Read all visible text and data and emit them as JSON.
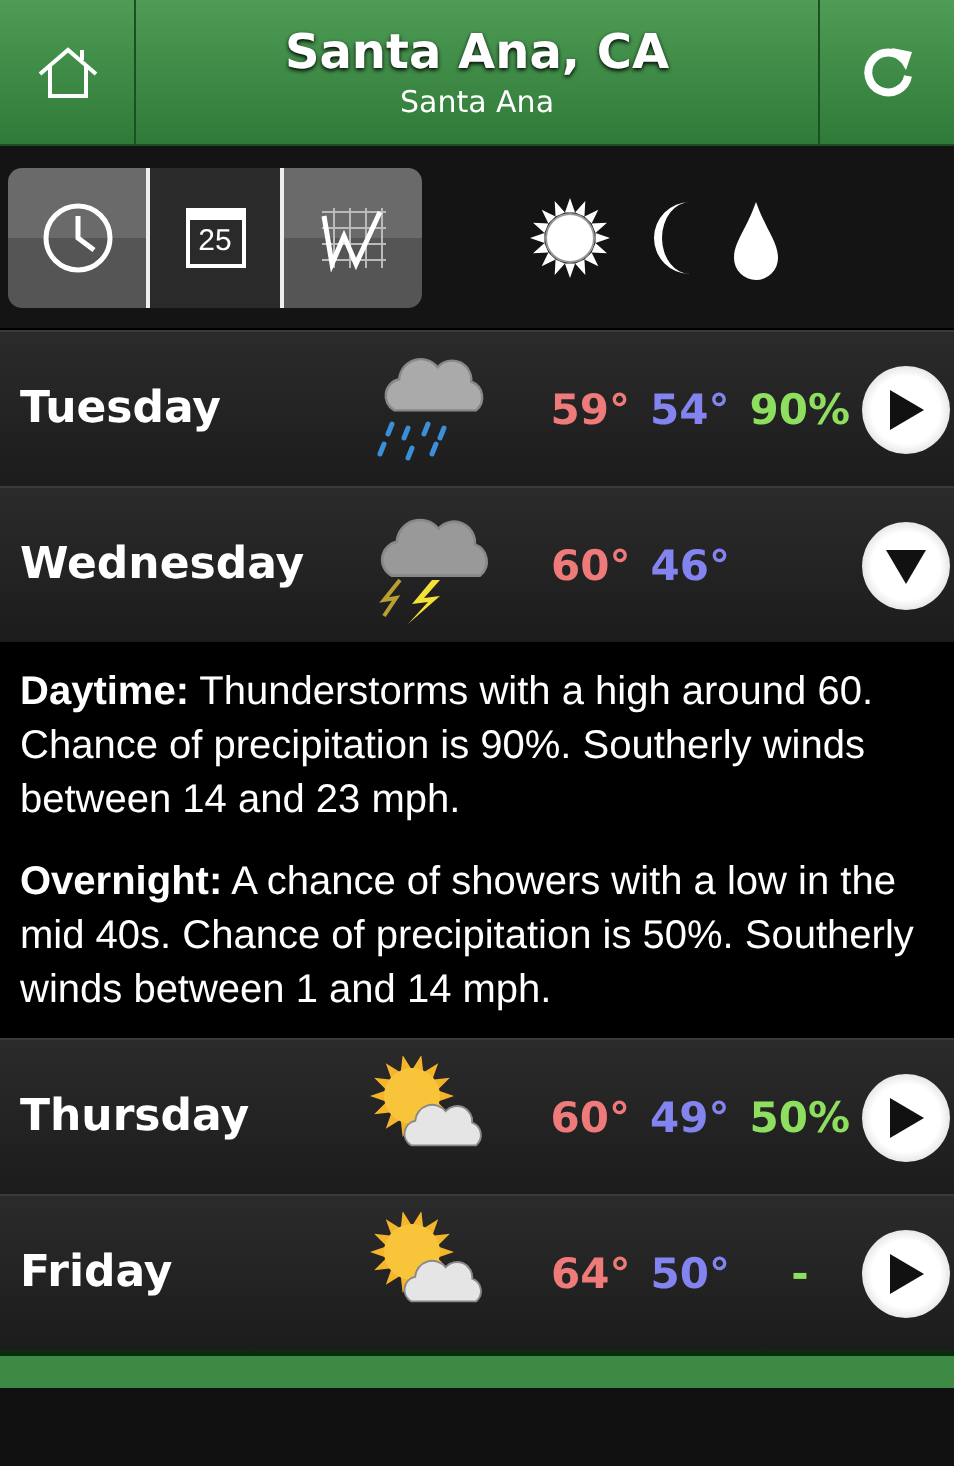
{
  "header": {
    "title": "Santa Ana, CA",
    "subtitle": "Santa Ana"
  },
  "view_tabs": [
    {
      "kind": "clock",
      "selected": false
    },
    {
      "kind": "calendar",
      "label": "25",
      "selected": true
    },
    {
      "kind": "chart",
      "selected": false
    }
  ],
  "legend": [
    {
      "kind": "sun"
    },
    {
      "kind": "moon"
    },
    {
      "kind": "drop"
    }
  ],
  "days": [
    {
      "name": "Tuesday",
      "kind": "rain",
      "high": "59°",
      "low": "54°",
      "precip": "90%",
      "expanded": false
    },
    {
      "name": "Wednesday",
      "kind": "storm",
      "high": "60°",
      "low": "46°",
      "expanded": true,
      "details": [
        "**Daytime:** Thunderstorms with a high around 60. Chance of precipitation is 90%. Southerly winds between 14 and 23 mph.",
        "**Overnight:** A chance of showers with a low in the mid 40s. Chance of precipitation is 50%. Southerly winds between 1 and 14 mph."
      ]
    },
    {
      "name": "Thursday",
      "kind": "partly_sunny",
      "high": "60°",
      "low": "49°",
      "precip": "50%",
      "expanded": false
    },
    {
      "name": "Friday",
      "kind": "partly_sunny",
      "high": "64°",
      "low": "50°",
      "precip": "-",
      "expanded": false
    }
  ]
}
